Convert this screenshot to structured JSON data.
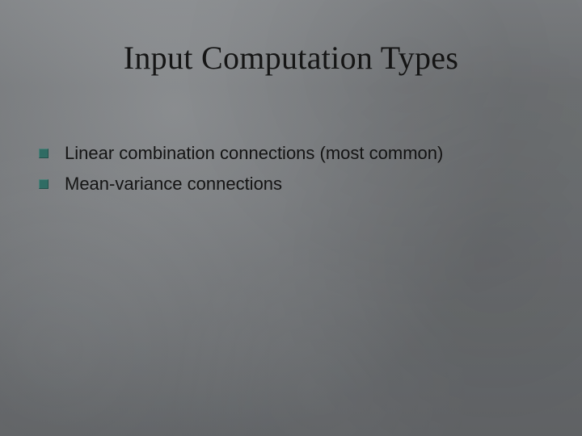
{
  "slide": {
    "title": "Input Computation Types",
    "bullets": [
      {
        "text": "Linear combination connections (most common)"
      },
      {
        "text": "Mean-variance connections"
      }
    ]
  },
  "theme": {
    "bullet_color": "#2f6b63",
    "background_base": "#7d8083"
  }
}
